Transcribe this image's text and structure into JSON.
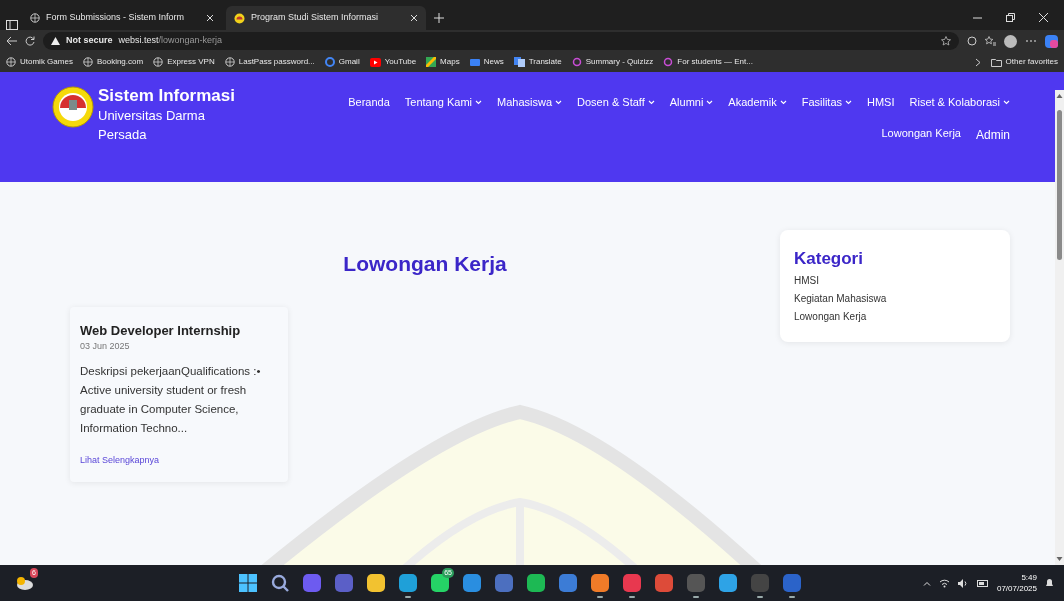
{
  "browser": {
    "tabs": [
      {
        "title": "Form Submissions - Sistem Inform",
        "kind": "globe",
        "selected": false
      },
      {
        "title": "Program Studi Sistem Informasi",
        "kind": "logo",
        "selected": true
      }
    ],
    "address": {
      "security": "Not secure",
      "host": "websi.test",
      "path": "/lowongan-kerja"
    },
    "bookmarks": [
      {
        "label": "Utomik Games",
        "kind": "globe"
      },
      {
        "label": "Booking.com",
        "kind": "globe"
      },
      {
        "label": "Express VPN",
        "kind": "globe"
      },
      {
        "label": "LastPass password...",
        "kind": "globe"
      },
      {
        "label": "Gmail",
        "kind": "g"
      },
      {
        "label": "YouTube",
        "kind": "youtube"
      },
      {
        "label": "Maps",
        "kind": "maps"
      },
      {
        "label": "News",
        "kind": "news"
      },
      {
        "label": "Translate",
        "kind": "translate"
      },
      {
        "label": "Summary - Quizizz",
        "kind": "q"
      },
      {
        "label": "For students — Ent...",
        "kind": "q"
      }
    ],
    "other_favorites": "Other favorites"
  },
  "site": {
    "brand": {
      "title": "Sistem Informasi",
      "subtitle": "Universitas Darma Persada"
    },
    "nav": [
      {
        "label": "Beranda",
        "dropdown": false,
        "kind": "link"
      },
      {
        "label": "Tentang Kami",
        "dropdown": true,
        "kind": "link"
      },
      {
        "label": "Mahasiswa",
        "dropdown": true,
        "kind": "link"
      },
      {
        "label": "Dosen & Staff",
        "dropdown": true,
        "kind": "link"
      },
      {
        "label": "Alumni",
        "dropdown": true,
        "kind": "link"
      },
      {
        "label": "Akademik",
        "dropdown": true,
        "kind": "link"
      },
      {
        "label": "Fasilitas",
        "dropdown": true,
        "kind": "link"
      },
      {
        "label": "HMSI",
        "dropdown": false,
        "kind": "link"
      },
      {
        "label": "Riset & Kolaborasi",
        "dropdown": true,
        "kind": "link"
      },
      {
        "label": "Lowongan Kerja",
        "dropdown": false,
        "kind": "link"
      },
      {
        "label": "Admin",
        "dropdown": false,
        "kind": "admin"
      }
    ],
    "heading": "Lowongan Kerja",
    "jobs": [
      {
        "title": "Web Developer Internship",
        "date": "03 Jun 2025",
        "excerpt": "Deskripsi pekerjaanQualifications :• Active university student or fresh graduate in Computer Science, Information Techno...",
        "link": "Lihat Selengkapnya"
      }
    ],
    "categories": {
      "title": "Kategori",
      "items": [
        "HMSI",
        "Kegiatan Mahasiswa",
        "Lowongan Kerja"
      ]
    }
  },
  "taskbar": {
    "widget_badge": "6",
    "apps": [
      {
        "kind": "start",
        "running": false
      },
      {
        "kind": "search",
        "running": false
      },
      {
        "kind": "copilot",
        "running": false
      },
      {
        "kind": "teams",
        "running": false
      },
      {
        "kind": "explorer",
        "running": false
      },
      {
        "kind": "edge",
        "running": true
      },
      {
        "kind": "whatsapp",
        "running": false,
        "badge": "65"
      },
      {
        "kind": "vscode",
        "running": false
      },
      {
        "kind": "link",
        "running": false
      },
      {
        "kind": "spotify",
        "running": false
      },
      {
        "kind": "photos",
        "running": false
      },
      {
        "kind": "xampp",
        "running": true
      },
      {
        "kind": "wps",
        "running": true
      },
      {
        "kind": "chrome",
        "running": false
      },
      {
        "kind": "console",
        "running": true
      },
      {
        "kind": "bluebird",
        "running": false
      },
      {
        "kind": "terminal",
        "running": true
      },
      {
        "kind": "word",
        "running": true
      }
    ],
    "time": "5:49",
    "date": "07/07/2025"
  }
}
